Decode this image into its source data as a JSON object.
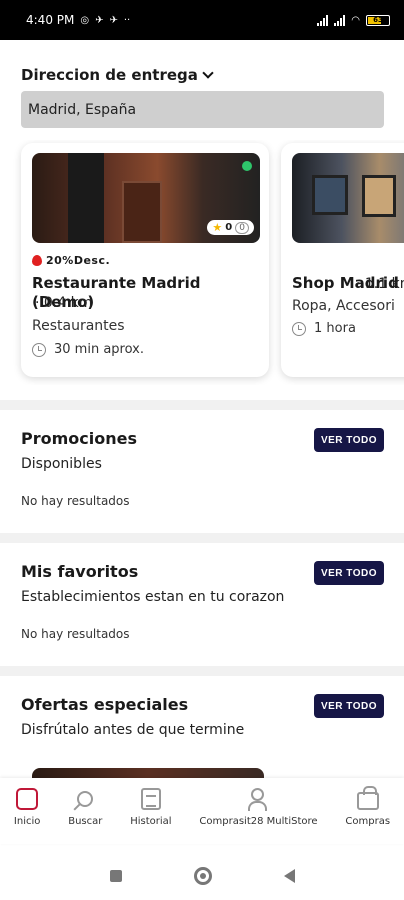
{
  "status_bar": {
    "time": "4:40 PM",
    "battery": "63"
  },
  "address": {
    "label": "Direccion de entrega",
    "value": "Madrid, España"
  },
  "stores": [
    {
      "discount": "20%Desc.",
      "name": "Restaurante Madrid (Demo)",
      "distance": "· 0.4 km",
      "category": "Restaurantes",
      "delivery_time": "30 min aprox.",
      "rating": "0",
      "rating_count": "0"
    },
    {
      "name": "Shop Madrid E (Demo)",
      "distance": "· 1.1 km",
      "category": "Ropa, Accesori",
      "delivery_time": "1 hora"
    }
  ],
  "sections": {
    "promos": {
      "title": "Promociones",
      "subtitle": "Disponibles",
      "empty": "No hay resultados",
      "button": "VER TODO"
    },
    "favorites": {
      "title": "Mis favoritos",
      "subtitle": "Establecimientos estan en tu corazon",
      "empty": "No hay resultados",
      "button": "VER TODO"
    },
    "offers": {
      "title": "Ofertas especiales",
      "subtitle": "Disfrútalo antes de que termine",
      "button": "VER TODO"
    }
  },
  "nav": {
    "home": "Inicio",
    "search": "Buscar",
    "history": "Historial",
    "multistore": "Comprasit28 MultiStore",
    "purchases": "Compras"
  },
  "colors": {
    "primary_dark": "#161646",
    "accent_red": "#c01838",
    "online_green": "#2ec66b"
  }
}
